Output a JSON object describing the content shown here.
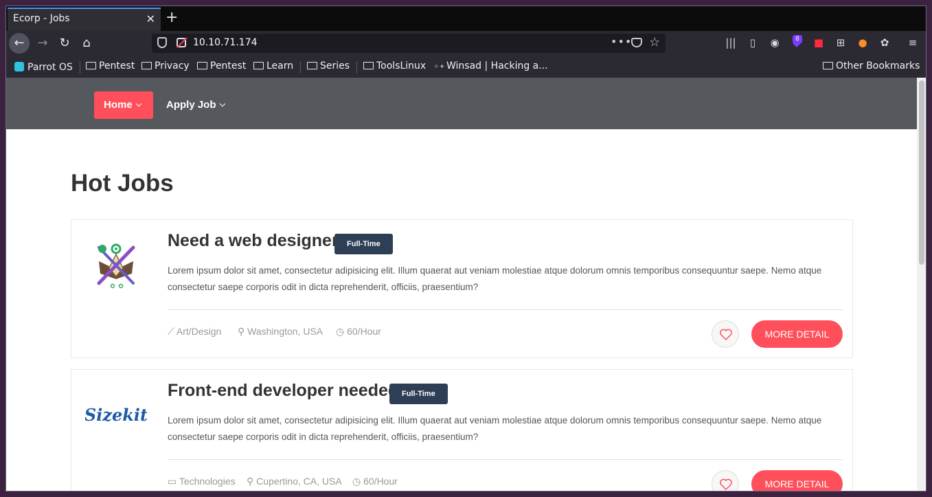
{
  "browser": {
    "tab_title": "Ecorp - Jobs",
    "tab_close": "✕",
    "new_tab": "+",
    "url": "10.10.71.174",
    "url_dots": "•••",
    "toolbar_badge": "8"
  },
  "bookmarks": {
    "items": [
      "Parrot OS",
      "Pentest",
      "Privacy",
      "Pentest",
      "Learn",
      "Series",
      "ToolsLinux",
      "Winsad | Hacking a..."
    ],
    "other": "Other Bookmarks"
  },
  "site": {
    "nav": {
      "home": "Home",
      "apply": "Apply Job"
    },
    "heading": "Hot Jobs",
    "jobs": [
      {
        "title": "Need a web designer",
        "type": "Full-Time",
        "description": "Lorem ipsum dolor sit amet, consectetur adipisicing elit. Illum quaerat aut veniam molestiae atque dolorum omnis temporibus consequuntur saepe. Nemo atque consectetur saepe corporis odit in dicta reprehenderit, officiis, praesentium?",
        "category": "Art/Design",
        "location": "Washington, USA",
        "rate": "60/Hour",
        "button": "MORE DETAIL"
      },
      {
        "title": "Front-end developer needed",
        "type": "Full-Time",
        "description": "Lorem ipsum dolor sit amet, consectetur adipisicing elit. Illum quaerat aut veniam molestiae atque dolorum omnis temporibus consequuntur saepe. Nemo atque consectetur saepe corporis odit in dicta reprehenderit, officiis, praesentium?",
        "category": "Technologies",
        "location": "Cupertino, CA, USA",
        "rate": "60/Hour",
        "button": "MORE DETAIL",
        "logo_text": "Sizekit"
      }
    ]
  },
  "colors": {
    "accent": "#ff4f5a",
    "badge": "#2e3f55",
    "nav_bg": "#55585d"
  }
}
